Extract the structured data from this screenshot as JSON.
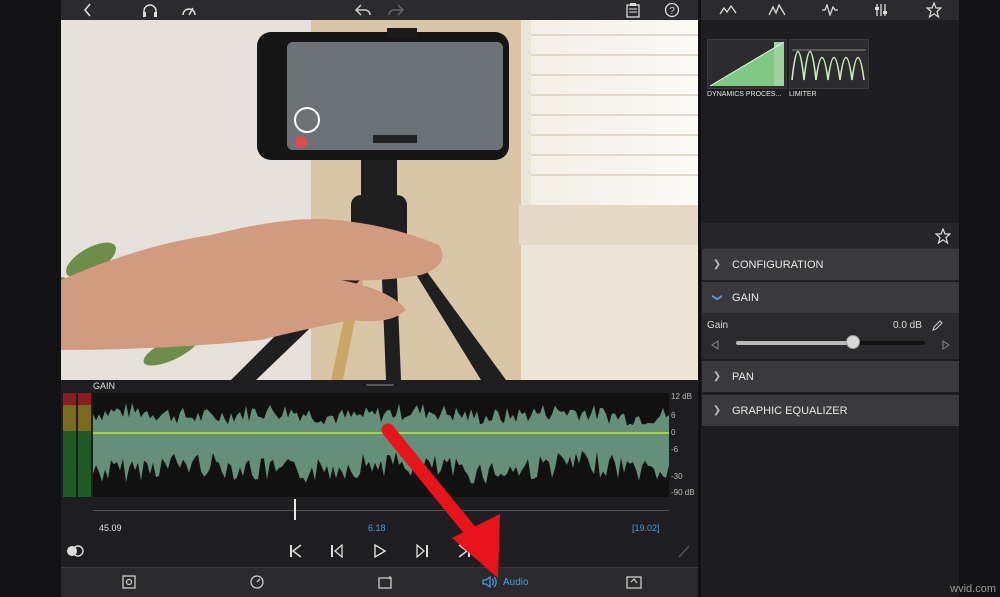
{
  "toolbar": {
    "icons": [
      "back-chevron-icon",
      "headphones-icon",
      "speedometer-icon",
      "undo-icon",
      "redo-icon",
      "clipboard-icon",
      "help-icon"
    ],
    "help_glyph": "?"
  },
  "timeline": {
    "label": "GAIN",
    "db_scale": [
      "12 dB",
      "6",
      "0",
      "-6",
      "-30",
      "-90 dB"
    ],
    "timecode_left": "45.09",
    "timecode_center": "6.18",
    "timecode_right": "[19.02]",
    "playhead_fraction": 0.35
  },
  "bottom_bar": {
    "audio_label": "Audio",
    "accent_color": "#4a9fe8"
  },
  "right_panel": {
    "tabs": [
      "zigzag-icon",
      "peaks-icon",
      "waveform-icon",
      "equalizer-icon",
      "star-icon"
    ],
    "effects": [
      {
        "label": "DYNAMICS PROCES..."
      },
      {
        "label": "LIMITER"
      }
    ],
    "sections": {
      "configuration": "CONFIGURATION",
      "gain": "GAIN",
      "pan": "PAN",
      "graphic_equalizer": "GRAPHIC EQUALIZER"
    },
    "gain_param": {
      "label": "Gain",
      "value": "0.0 dB",
      "slider_fraction": 0.62
    }
  },
  "watermark": "wvid.com"
}
